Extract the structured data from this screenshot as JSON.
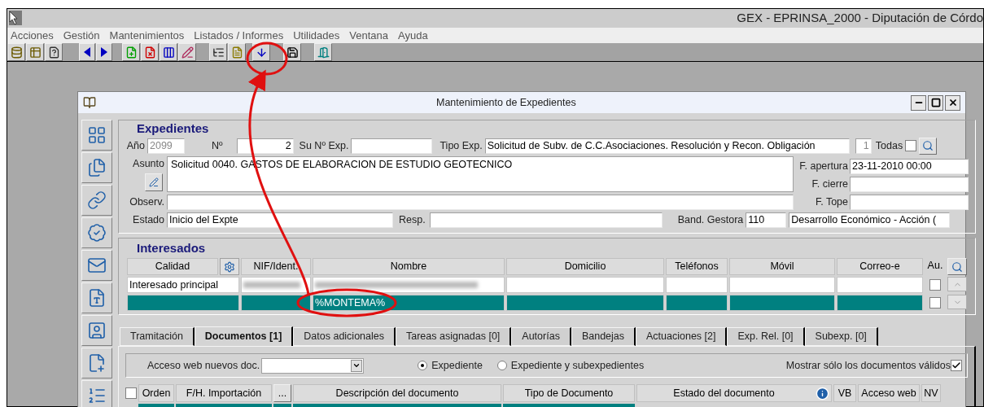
{
  "app_window": {
    "title": "GEX - EPRINSA_2000 - Diputación de Córdo"
  },
  "menu": [
    "Acciones",
    "Gestión",
    "Mantenimientos",
    "Listados / Informes",
    "Utilidades",
    "Ventana",
    "Ayuda"
  ],
  "child_window": {
    "title": "Mantenimiento de Expedientes"
  },
  "expedientes": {
    "heading": "Expedientes",
    "anio": {
      "label": "Año",
      "value": "2099",
      "disabled": true
    },
    "numero": {
      "label": "Nº",
      "value": "2"
    },
    "su_no_exp": {
      "label": "Su Nº Exp."
    },
    "tipo_exp": {
      "label": "Tipo Exp.",
      "value": "Solicitud de Subv. de C.C.Asociaciones. Resolución y Recon. Obligación",
      "count": "1"
    },
    "todas": {
      "label": "Todas",
      "checked": false
    },
    "asunto": {
      "label": "Asunto",
      "value": "Solicitud 0040. GASTOS DE ELABORACION DE ESTUDIO GEOTECNICO"
    },
    "observ": {
      "label": "Observ."
    },
    "estado": {
      "label": "Estado",
      "value": "Inicio del Expte"
    },
    "resp": {
      "label": "Resp."
    },
    "band_gestora": {
      "label": "Band. Gestora",
      "code": "110",
      "value": "Desarrollo Económico - Acción ("
    },
    "f_apertura": {
      "label": "F. apertura",
      "value": "23-11-2010 00:00"
    },
    "f_cierre": {
      "label": "F. cierre"
    },
    "f_tope": {
      "label": "F. Tope"
    }
  },
  "interesados": {
    "heading": "Interesados",
    "columns": [
      "Calidad",
      "NIF/Ident.",
      "Nombre",
      "Domicilio",
      "Teléfonos",
      "Móvil",
      "Correo-e",
      "Au."
    ],
    "rows": [
      {
        "calidad": "Interesado principal",
        "redacted": true,
        "selected": false,
        "checked": false
      },
      {
        "nombre": "%MONTEMA%",
        "redacted": false,
        "selected": true,
        "checked": false
      }
    ]
  },
  "tabs": [
    {
      "label": "Tramitación",
      "selected": false
    },
    {
      "label": "Documentos [1]",
      "selected": true
    },
    {
      "label": "Datos adicionales",
      "selected": false
    },
    {
      "label": "Tareas asignadas [0]",
      "selected": false
    },
    {
      "label": "Autorías",
      "selected": false
    },
    {
      "label": "Bandejas",
      "selected": false
    },
    {
      "label": "Actuaciones [2]",
      "selected": false
    },
    {
      "label": "Exp. Rel. [0]",
      "selected": false
    },
    {
      "label": "Subexp. [0]",
      "selected": false
    }
  ],
  "documentos": {
    "acceso_web": {
      "label": "Acceso web nuevos doc."
    },
    "radios": [
      {
        "label": "Expediente",
        "selected": true
      },
      {
        "label": "Expediente y subexpedientes",
        "selected": false
      }
    ],
    "mostrar_validos": {
      "label": "Mostrar sólo los documentos válidos",
      "checked": true
    },
    "select_all": {
      "checked": false
    },
    "columns": [
      {
        "label": "Orden",
        "kind": "text"
      },
      {
        "label": "F/H. Importación",
        "kind": "text"
      },
      {
        "label": "...",
        "kind": "button"
      },
      {
        "label": "Descripción del documento",
        "kind": "text"
      },
      {
        "label": "Tipo de Documento",
        "kind": "text"
      },
      {
        "label": "Estado del documento",
        "kind": "info"
      },
      {
        "label": "VB",
        "kind": "text"
      },
      {
        "label": "Acceso web",
        "kind": "text"
      },
      {
        "label": "NV",
        "kind": "text"
      }
    ]
  }
}
